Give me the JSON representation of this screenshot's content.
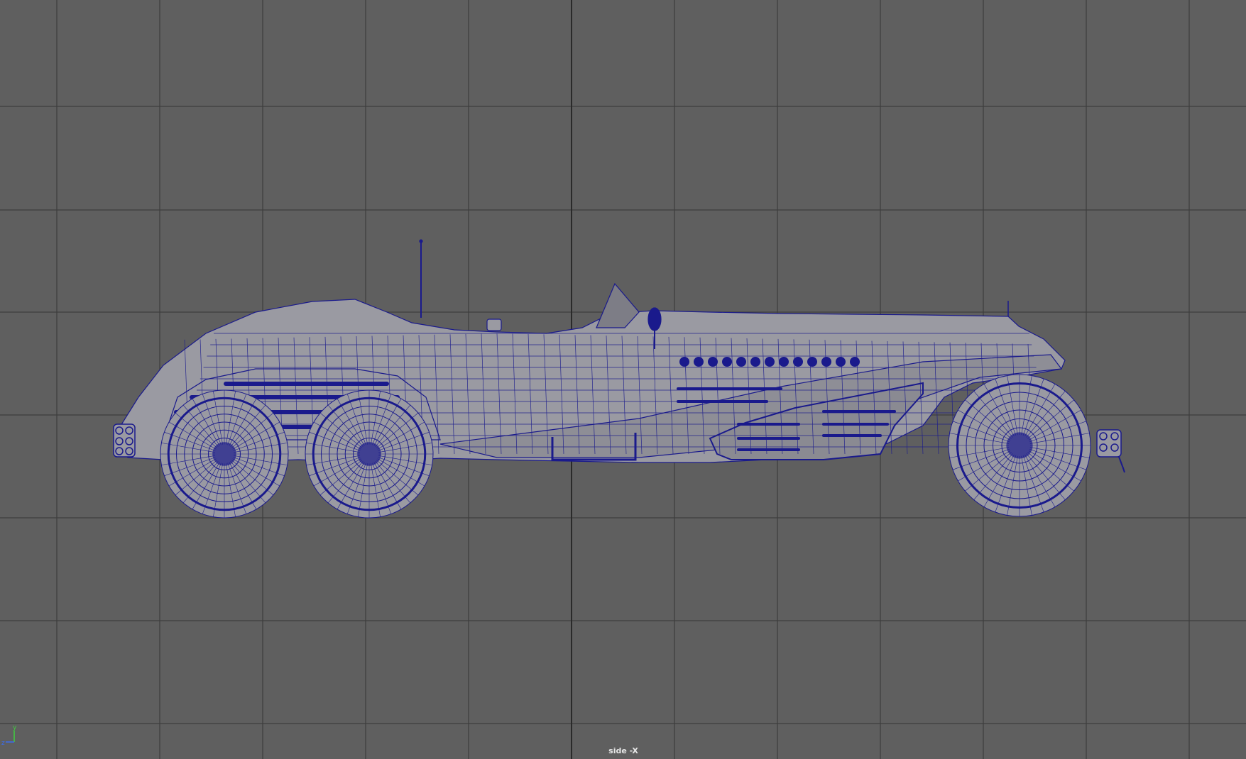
{
  "viewport": {
    "camera_label": "side -X",
    "background_color": "#5f5f5f",
    "grid_color": "#3d3d3d",
    "grid_axis_color": "#2a2a2a",
    "wireframe_color": "#1a1a8c",
    "surface_color": "#9a9aa2"
  },
  "gizmo": {
    "y_label": "y",
    "z_label": "z",
    "y_color": "#3fd13f",
    "z_color": "#3a6df0"
  },
  "model": {
    "name": "car-wireframe",
    "icon": "car-wireframe-model"
  }
}
